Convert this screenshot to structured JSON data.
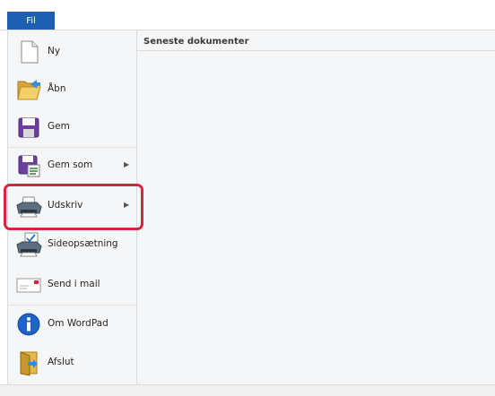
{
  "file_tab": {
    "label": "Fil"
  },
  "recent": {
    "title": "Seneste dokumenter"
  },
  "menu": {
    "items": [
      {
        "label": "Ny",
        "icon": "new-document-icon",
        "submenu": false
      },
      {
        "label": "Åbn",
        "icon": "open-folder-icon",
        "submenu": false
      },
      {
        "label": "Gem",
        "icon": "save-icon",
        "submenu": false
      },
      {
        "label": "Gem som",
        "icon": "save-as-icon",
        "submenu": true
      },
      {
        "label": "Udskriv",
        "icon": "printer-icon",
        "submenu": true,
        "highlighted": true
      },
      {
        "label": "Sideopsætning",
        "icon": "page-setup-icon",
        "submenu": false
      },
      {
        "label": "Send i mail",
        "icon": "mail-icon",
        "submenu": false
      },
      {
        "label": "Om WordPad",
        "icon": "info-icon",
        "submenu": false
      },
      {
        "label": "Afslut",
        "icon": "exit-icon",
        "submenu": false
      }
    ]
  },
  "colors": {
    "file_tab": "#1f5fb0",
    "highlight": "#d8253f",
    "panel": "#f5f6f7"
  }
}
